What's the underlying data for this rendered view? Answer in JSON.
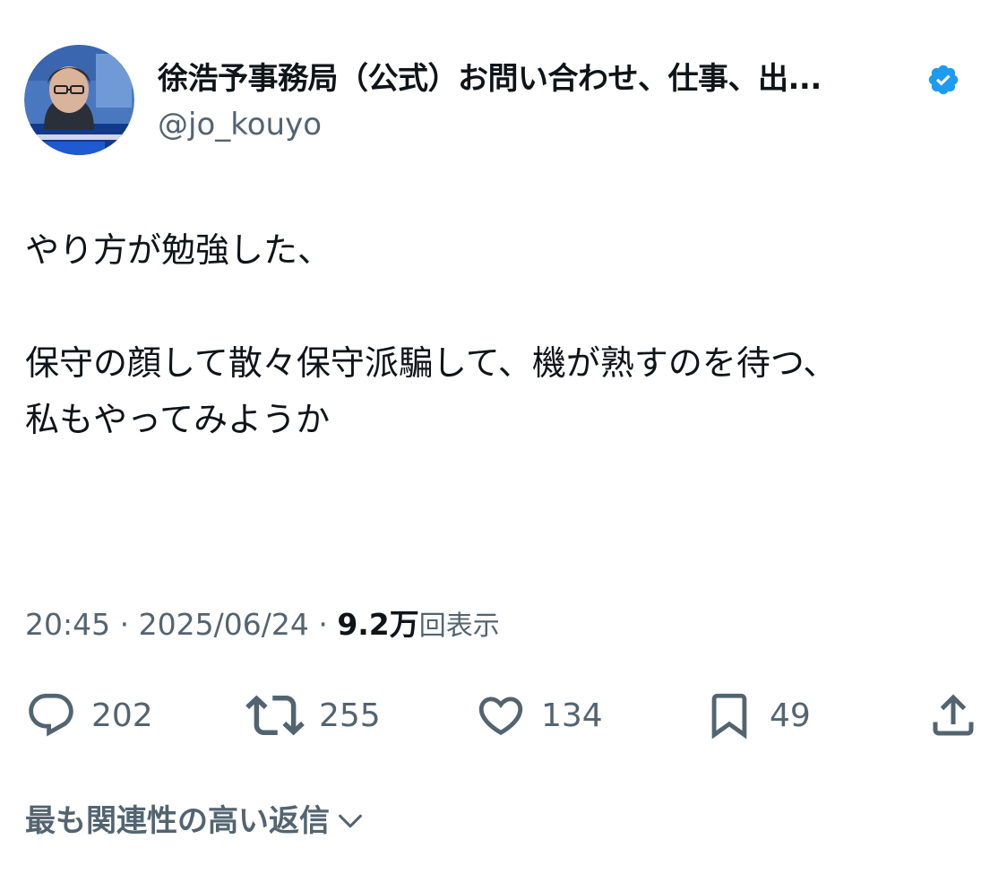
{
  "author": {
    "display_name": "徐浩予事務局（公式）お問い合わせ、仕事、出...",
    "handle": "@jo_kouyo",
    "verified": true,
    "verified_color": "#1d9bf0",
    "avatar_icon": "profile-photo"
  },
  "tweet": {
    "text": "やり方が勉強した、\n\n保守の顔して散々保守派騙して、機が熟すのを待つ、\n私もやってみようか"
  },
  "meta": {
    "time": "20:45",
    "separator": "·",
    "date": "2025/06/24",
    "views_count": "9.2万",
    "views_label": "回表示"
  },
  "actions": {
    "replies": "202",
    "retweets": "255",
    "likes": "134",
    "bookmarks": "49"
  },
  "replies_sort": {
    "label": "最も関連性の高い返信",
    "icon": "chevron-down-icon"
  },
  "colors": {
    "text": "#0f1419",
    "secondary": "#536471",
    "accent": "#1d9bf0"
  }
}
